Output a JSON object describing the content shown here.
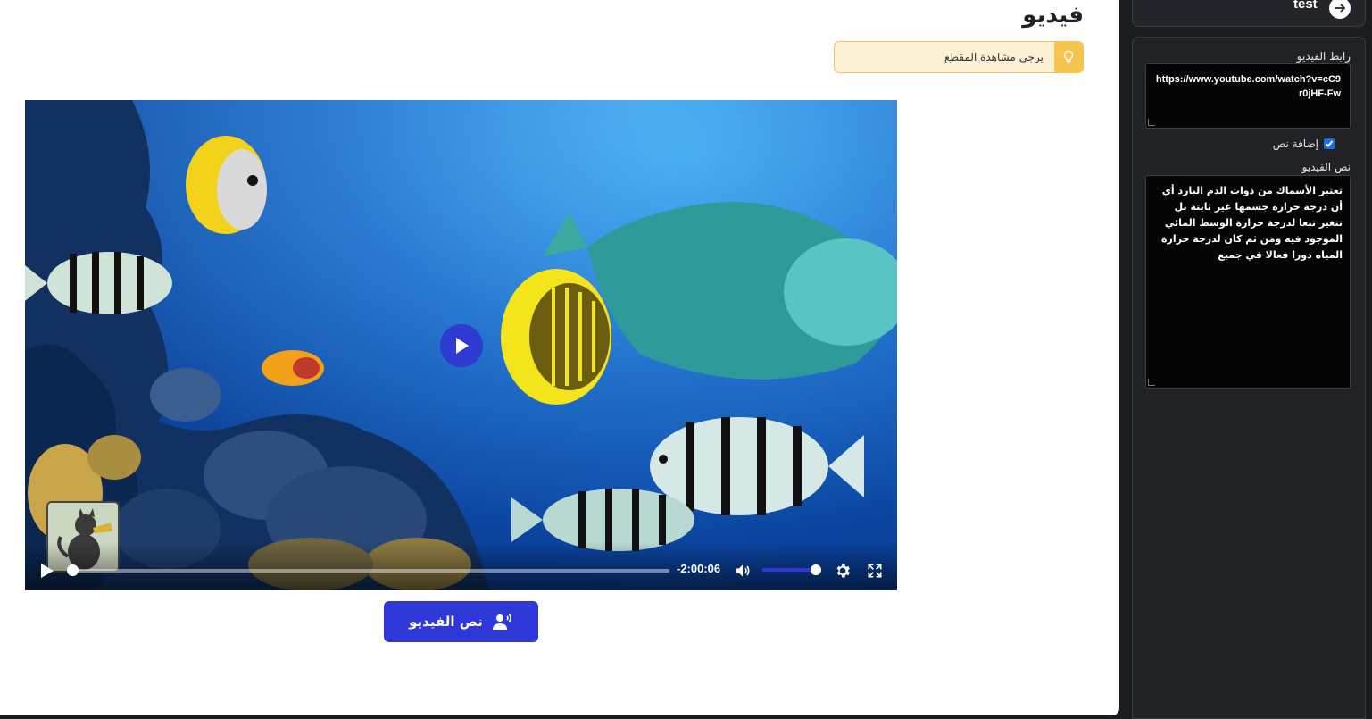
{
  "page": {
    "title": "فيديو",
    "hint": "يرجى مشاهدة المقطع"
  },
  "player": {
    "time_remaining": "-2:00:06",
    "volume_level": 1.0,
    "progress": 0.0
  },
  "transcript_button_label": "نص الفيديو",
  "sidebar": {
    "top_card_title": "test",
    "url_label": "رابط الفيديو",
    "url_value": "https://www.youtube.com/watch?v=cC9r0jHF-Fw",
    "add_text_label": "إضافة نص",
    "add_text_checked": true,
    "text_label": "نص الفيديو",
    "text_value": "تعتبر الأسماك من ذوات الدم البارد أي أن درجة حرارة جسمها غير ثابتة بل تتغير تبعا لدرجة حرارة الوسط المائي الموجود فيه ومن ثم كان لدرجة حرارة المياه دورا فعالا في جميع"
  },
  "colors": {
    "accent": "#2e38d9",
    "hint_bg": "#fdf1d5",
    "hint_icon": "#f7c54b",
    "sidebar_bg": "#202226"
  }
}
